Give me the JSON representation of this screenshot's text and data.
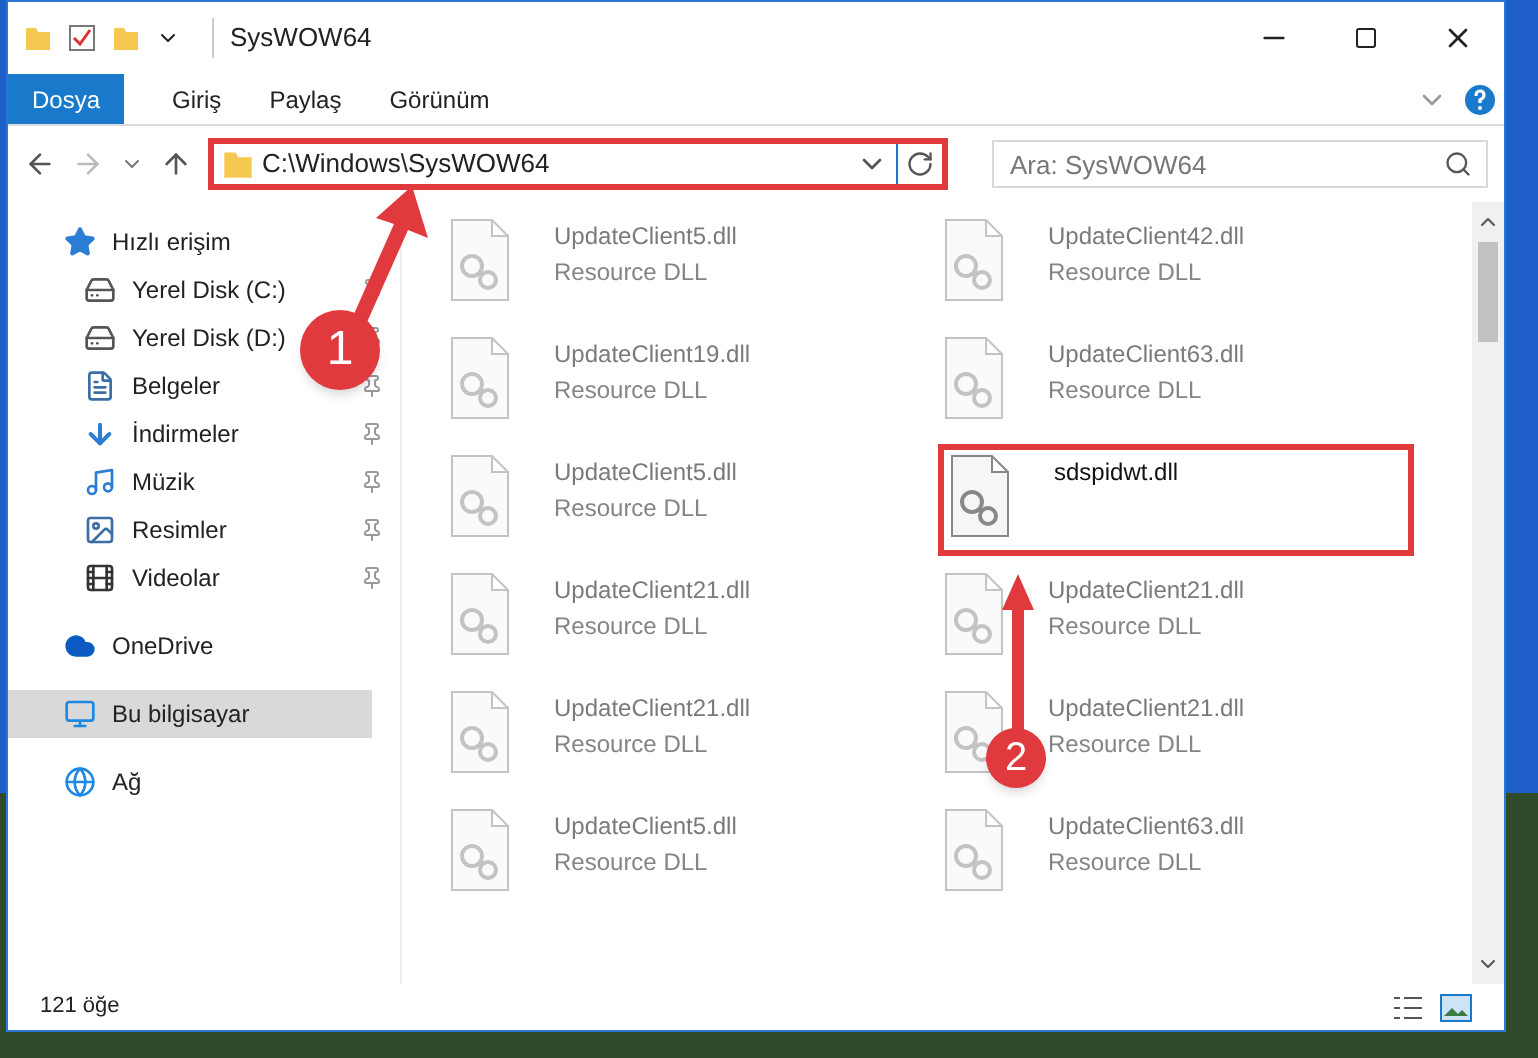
{
  "window": {
    "title": "SysWOW64"
  },
  "ribbon_tabs": [
    {
      "label": "Dosya",
      "selected": true
    },
    {
      "label": "Giriş",
      "selected": false
    },
    {
      "label": "Paylaş",
      "selected": false
    },
    {
      "label": "Görünüm",
      "selected": false
    }
  ],
  "address": {
    "path": "C:\\Windows\\SysWOW64",
    "highlighted": true
  },
  "search": {
    "placeholder": "Ara: SysWOW64"
  },
  "sidebar": {
    "items": [
      {
        "label": "Hızlı erişim",
        "selected": false,
        "children": [
          {
            "label": "Yerel Disk (C:)",
            "pinned": true
          },
          {
            "label": "Yerel Disk (D:)",
            "pinned": true
          },
          {
            "label": "Belgeler",
            "pinned": true
          },
          {
            "label": "İndirmeler",
            "pinned": true
          },
          {
            "label": "Müzik",
            "pinned": true
          },
          {
            "label": "Resimler",
            "pinned": true
          },
          {
            "label": "Videolar",
            "pinned": true
          }
        ]
      },
      {
        "label": "OneDrive",
        "selected": false
      },
      {
        "label": "Bu bilgisayar",
        "selected": true
      },
      {
        "label": "Ağ",
        "selected": false
      }
    ]
  },
  "files": [
    {
      "name": "UpdateClient5.dll",
      "type": "Resource DLL",
      "dimmed": true,
      "highlighted": false
    },
    {
      "name": "UpdateClient42.dll",
      "type": "Resource DLL",
      "dimmed": true,
      "highlighted": false
    },
    {
      "name": "UpdateClient19.dll",
      "type": "Resource DLL",
      "dimmed": true,
      "highlighted": false
    },
    {
      "name": "UpdateClient63.dll",
      "type": "Resource DLL",
      "dimmed": true,
      "highlighted": false
    },
    {
      "name": "UpdateClient5.dll",
      "type": "Resource DLL",
      "dimmed": true,
      "highlighted": false
    },
    {
      "name": "sdspidwt.dll",
      "dimmed": false,
      "highlighted": true
    },
    {
      "name": "UpdateClient21.dll",
      "type": "Resource DLL",
      "dimmed": true,
      "highlighted": false
    },
    {
      "name": "UpdateClient21.dll",
      "type": "Resource DLL",
      "dimmed": true,
      "highlighted": false
    },
    {
      "name": "UpdateClient21.dll",
      "type": "Resource DLL",
      "dimmed": true,
      "highlighted": false
    },
    {
      "name": "UpdateClient21.dll",
      "type": "Resource DLL",
      "dimmed": true,
      "highlighted": false
    },
    {
      "name": "UpdateClient5.dll",
      "type": "Resource DLL",
      "dimmed": true,
      "highlighted": false
    },
    {
      "name": "UpdateClient63.dll",
      "type": "Resource DLL",
      "dimmed": true,
      "highlighted": false
    }
  ],
  "annotations": [
    {
      "number": "1"
    },
    {
      "number": "2"
    }
  ],
  "status_bar": {
    "count": "121 öğe"
  }
}
